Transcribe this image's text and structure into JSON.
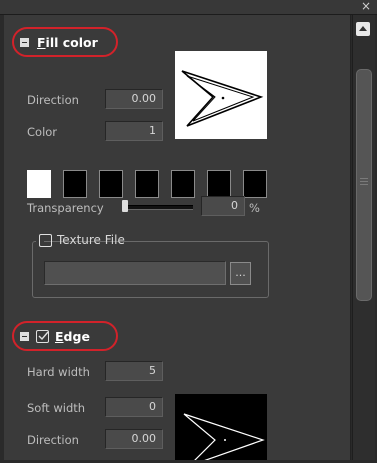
{
  "window": {
    "close_glyph": "×"
  },
  "fill": {
    "title_accel": "F",
    "title_rest": "ill color",
    "direction_label": "Direction",
    "direction_value": "0.00",
    "color_label": "Color",
    "color_value": "1",
    "swatches": [
      "#ffffff",
      "#000000",
      "#000000",
      "#000000",
      "#000000",
      "#000000",
      "#000000",
      "#000000"
    ],
    "transparency_label": "Transparency",
    "transparency_value": "0",
    "transparency_unit": "%",
    "texture_label": "Texture File",
    "texture_value": "",
    "browse_label": "..."
  },
  "edge": {
    "title_accel": "E",
    "title_rest": "dge",
    "hard_width_label": "Hard width",
    "hard_width_value": "5",
    "soft_width_label": "Soft width",
    "soft_width_value": "0",
    "direction_label": "Direction",
    "direction_value": "0.00"
  },
  "colors": {
    "highlight_ring": "#d2222a",
    "panel_bg": "#3a3a3a"
  }
}
